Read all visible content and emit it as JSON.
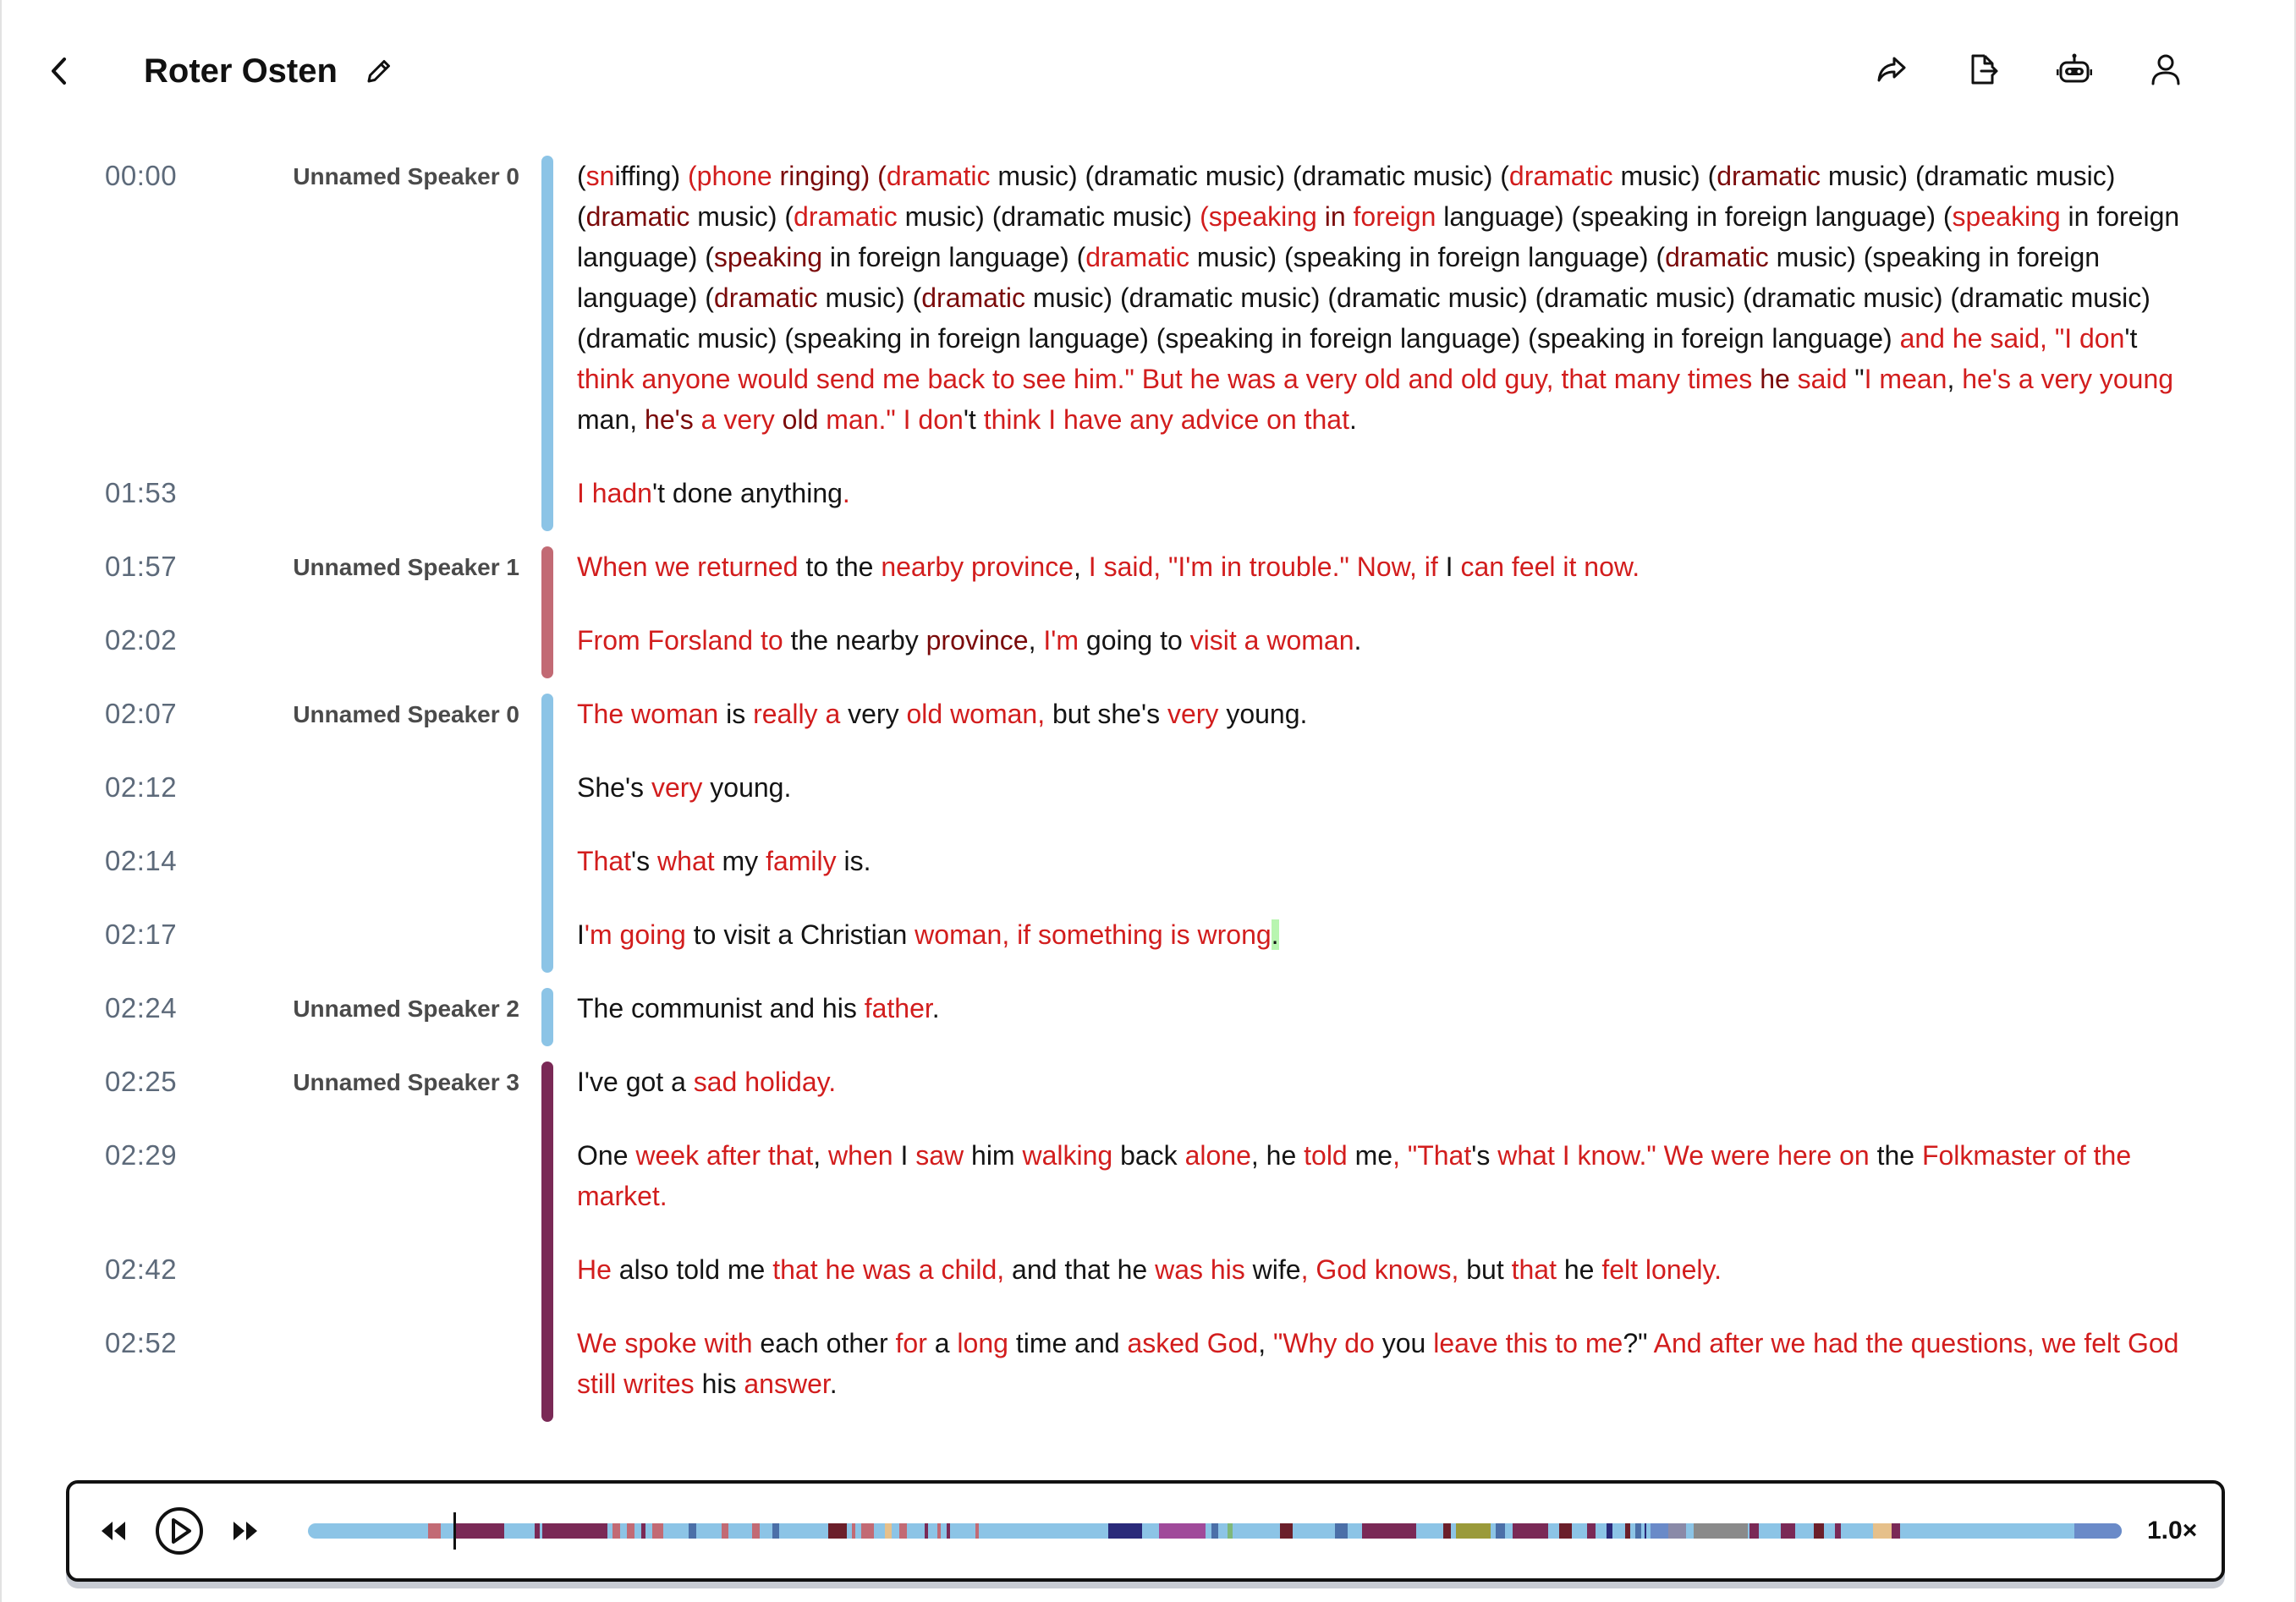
{
  "header": {
    "title": "Roter Osten",
    "icons": [
      "back-chevron-icon",
      "pencil-icon",
      "share-icon",
      "export-file-icon",
      "robot-icon",
      "user-icon"
    ]
  },
  "colors": {
    "speaker_0": "#8cc4e6",
    "speaker_1": "#c26a74",
    "speaker_2": "#8cc4e6",
    "speaker_3": "#7a2956",
    "low_confidence": "#d21d1d",
    "medium_confidence": "#7a0a0a"
  },
  "transcript": {
    "groups": [
      {
        "speaker": "Unnamed Speaker 0",
        "color": "#8cc4e6",
        "segments": [
          {
            "time": "00:00",
            "spans": [
              [
                "(",
                ""
              ],
              [
                "sn",
                "r"
              ],
              [
                "iffing) ",
                ""
              ],
              [
                "(phone",
                "r"
              ],
              [
                " ringing) (",
                "d"
              ],
              [
                "dramatic",
                "r"
              ],
              [
                " music) (dramatic music) (dramatic music) (",
                ""
              ],
              [
                "dramatic",
                "r"
              ],
              [
                " music) (",
                ""
              ],
              [
                "dramatic",
                "d"
              ],
              [
                " music) (dramatic music) (",
                ""
              ],
              [
                "dramatic",
                "d"
              ],
              [
                " music) (",
                ""
              ],
              [
                "dramatic",
                "r"
              ],
              [
                " music) (dramatic music) ",
                ""
              ],
              [
                "(speaking",
                "r"
              ],
              [
                " in ",
                "d"
              ],
              [
                "foreign",
                "r"
              ],
              [
                " language) (speaking in foreign language) (",
                ""
              ],
              [
                "speaking",
                "r"
              ],
              [
                " in foreign language) (",
                ""
              ],
              [
                "speaking",
                "d"
              ],
              [
                " in foreign language) (",
                ""
              ],
              [
                "dramatic",
                "r"
              ],
              [
                " music) (speaking in foreign language) (",
                ""
              ],
              [
                "dramatic",
                "d"
              ],
              [
                " music) (speaking in foreign language) (",
                ""
              ],
              [
                "dramatic",
                "d"
              ],
              [
                " music) (",
                ""
              ],
              [
                "dramatic",
                "d"
              ],
              [
                " music) (dramatic music) (dramatic music) (dramatic music) (dramatic music) (dramatic music) (dramatic music) (speaking in foreign language) (speaking in foreign language) (speaking in foreign language) ",
                ""
              ],
              [
                "and he said, \"I don",
                "r"
              ],
              [
                "'t ",
                ""
              ],
              [
                "think anyone would send me back to see him.\" But he was a very old and old guy, that many times",
                "r"
              ],
              [
                " he ",
                "d"
              ],
              [
                "said",
                "r"
              ],
              [
                " \"",
                ""
              ],
              [
                "I mean",
                "r"
              ],
              [
                ", ",
                ""
              ],
              [
                "he's a very young",
                "r"
              ],
              [
                " man, ",
                ""
              ],
              [
                "he's",
                "d"
              ],
              [
                " ",
                ""
              ],
              [
                "a very",
                "r"
              ],
              [
                " old ",
                "d"
              ],
              [
                "man.\" I don",
                "r"
              ],
              [
                "'t ",
                ""
              ],
              [
                "think I have any advice on that",
                "r"
              ],
              [
                ".",
                ""
              ]
            ]
          },
          {
            "time": "01:53",
            "spans": [
              [
                "I ",
                "r"
              ],
              [
                "hadn",
                "r"
              ],
              [
                "'t done anything",
                ""
              ],
              [
                ".",
                "r"
              ]
            ]
          }
        ]
      },
      {
        "speaker": "Unnamed Speaker 1",
        "color": "#c26a74",
        "segments": [
          {
            "time": "01:57",
            "spans": [
              [
                "When we returned",
                "r"
              ],
              [
                " to the ",
                ""
              ],
              [
                "nearby province",
                "r"
              ],
              [
                ", ",
                ""
              ],
              [
                "I said, \"",
                "r"
              ],
              [
                "I'm in trouble.\" Now, if",
                "r"
              ],
              [
                " I ",
                ""
              ],
              [
                "can feel it now.",
                "r"
              ]
            ]
          },
          {
            "time": "02:02",
            "spans": [
              [
                "From Forsland to",
                "r"
              ],
              [
                " the nearby ",
                ""
              ],
              [
                "province",
                "d"
              ],
              [
                ", ",
                ""
              ],
              [
                "I'm",
                "r"
              ],
              [
                " going to ",
                ""
              ],
              [
                "visit a woman",
                "r"
              ],
              [
                ".",
                ""
              ]
            ]
          }
        ]
      },
      {
        "speaker": "Unnamed Speaker 0",
        "color": "#8cc4e6",
        "segments": [
          {
            "time": "02:07",
            "spans": [
              [
                "The woman",
                "r"
              ],
              [
                " is ",
                ""
              ],
              [
                "really a",
                "r"
              ],
              [
                " very ",
                ""
              ],
              [
                "old woman,",
                "r"
              ],
              [
                " but she's ",
                ""
              ],
              [
                "very",
                "r"
              ],
              [
                " young.",
                ""
              ]
            ]
          },
          {
            "time": "02:12",
            "spans": [
              [
                "She's ",
                ""
              ],
              [
                "very",
                "r"
              ],
              [
                " young.",
                ""
              ]
            ]
          },
          {
            "time": "02:14",
            "spans": [
              [
                "That",
                "r"
              ],
              [
                "'s ",
                ""
              ],
              [
                "what",
                "r"
              ],
              [
                " my ",
                ""
              ],
              [
                "family",
                "r"
              ],
              [
                " is.",
                ""
              ]
            ]
          },
          {
            "time": "02:17",
            "spans": [
              [
                "I",
                ""
              ],
              [
                "'m going",
                "r"
              ],
              [
                " to visit a Christian ",
                ""
              ],
              [
                "woman, if something is wrong",
                "r"
              ],
              [
                ".",
                "hl"
              ]
            ]
          }
        ]
      },
      {
        "speaker": "Unnamed Speaker 2",
        "color": "#8cc4e6",
        "segments": [
          {
            "time": "02:24",
            "spans": [
              [
                "The communist and his ",
                ""
              ],
              [
                "father",
                "r"
              ],
              [
                ".",
                ""
              ]
            ]
          }
        ]
      },
      {
        "speaker": "Unnamed Speaker 3",
        "color": "#7a2956",
        "segments": [
          {
            "time": "02:25",
            "spans": [
              [
                "I've got a ",
                ""
              ],
              [
                "sad holiday.",
                "r"
              ]
            ]
          },
          {
            "time": "02:29",
            "spans": [
              [
                "One ",
                ""
              ],
              [
                "week after that",
                "r"
              ],
              [
                ", ",
                ""
              ],
              [
                "when",
                "r"
              ],
              [
                " I ",
                ""
              ],
              [
                "saw",
                "r"
              ],
              [
                " him ",
                ""
              ],
              [
                "walking",
                "r"
              ],
              [
                " back ",
                ""
              ],
              [
                "alone",
                "r"
              ],
              [
                ", he ",
                ""
              ],
              [
                "told",
                "r"
              ],
              [
                " me",
                ""
              ],
              [
                ", \"That",
                "r"
              ],
              [
                "'s ",
                ""
              ],
              [
                "what I know.\" We were here on",
                "r"
              ],
              [
                " the ",
                ""
              ],
              [
                "Folkmaster of the market.",
                "r"
              ]
            ]
          },
          {
            "time": "02:42",
            "spans": [
              [
                "He",
                "r"
              ],
              [
                " also told me ",
                ""
              ],
              [
                "that he was a child,",
                "r"
              ],
              [
                " and that he ",
                ""
              ],
              [
                "was his",
                "r"
              ],
              [
                " wife",
                ""
              ],
              [
                ", God knows,",
                "r"
              ],
              [
                " but ",
                ""
              ],
              [
                "that",
                "r"
              ],
              [
                " he ",
                ""
              ],
              [
                "felt lonely.",
                "r"
              ]
            ]
          },
          {
            "time": "02:52",
            "spans": [
              [
                "We ",
                "r"
              ],
              [
                "spoke with",
                "r"
              ],
              [
                " each other ",
                ""
              ],
              [
                "for",
                "r"
              ],
              [
                " a ",
                ""
              ],
              [
                "long",
                "r"
              ],
              [
                " time and ",
                ""
              ],
              [
                "asked God",
                "r"
              ],
              [
                ", ",
                ""
              ],
              [
                "\"Why do",
                "r"
              ],
              [
                " you ",
                ""
              ],
              [
                "leave this to me",
                "r"
              ],
              [
                "?\" ",
                ""
              ],
              [
                "And after we had the questions, we felt God still writes",
                "r"
              ],
              [
                " his ",
                ""
              ],
              [
                "answer",
                "r"
              ],
              [
                ".",
                ""
              ]
            ]
          }
        ]
      }
    ]
  },
  "player": {
    "speed": "1.0×",
    "position": 0.08,
    "timeline_segments": [
      {
        "s": 0.066,
        "e": 0.073,
        "c": "#c26a74"
      },
      {
        "s": 0.08,
        "e": 0.108,
        "c": "#7a2956"
      },
      {
        "s": 0.125,
        "e": 0.128,
        "c": "#7a2956"
      },
      {
        "s": 0.129,
        "e": 0.165,
        "c": "#7a2956"
      },
      {
        "s": 0.168,
        "e": 0.172,
        "c": "#c26a74"
      },
      {
        "s": 0.176,
        "e": 0.18,
        "c": "#c26a74"
      },
      {
        "s": 0.184,
        "e": 0.186,
        "c": "#7a2956"
      },
      {
        "s": 0.19,
        "e": 0.196,
        "c": "#c26a74"
      },
      {
        "s": 0.21,
        "e": 0.214,
        "c": "#4b6fa8"
      },
      {
        "s": 0.228,
        "e": 0.232,
        "c": "#c26a74"
      },
      {
        "s": 0.245,
        "e": 0.249,
        "c": "#c26a74"
      },
      {
        "s": 0.256,
        "e": 0.26,
        "c": "#4b6fa8"
      },
      {
        "s": 0.287,
        "e": 0.297,
        "c": "#6b1f2a"
      },
      {
        "s": 0.3,
        "e": 0.302,
        "c": "#c26a74"
      },
      {
        "s": 0.305,
        "e": 0.312,
        "c": "#c26a74"
      },
      {
        "s": 0.318,
        "e": 0.322,
        "c": "#e6c08a"
      },
      {
        "s": 0.326,
        "e": 0.33,
        "c": "#c26a74"
      },
      {
        "s": 0.34,
        "e": 0.342,
        "c": "#7a2956"
      },
      {
        "s": 0.347,
        "e": 0.349,
        "c": "#c26a74"
      },
      {
        "s": 0.352,
        "e": 0.354,
        "c": "#7a2956"
      },
      {
        "s": 0.368,
        "e": 0.37,
        "c": "#c26a74"
      },
      {
        "s": 0.441,
        "e": 0.46,
        "c": "#2a2a7a"
      },
      {
        "s": 0.469,
        "e": 0.495,
        "c": "#a04a9a"
      },
      {
        "s": 0.498,
        "e": 0.502,
        "c": "#4b6fa8"
      },
      {
        "s": 0.507,
        "e": 0.51,
        "c": "#7fb87a"
      },
      {
        "s": 0.536,
        "e": 0.543,
        "c": "#6b1f2a"
      },
      {
        "s": 0.566,
        "e": 0.573,
        "c": "#4b6fa8"
      },
      {
        "s": 0.581,
        "e": 0.611,
        "c": "#7a2956"
      },
      {
        "s": 0.626,
        "e": 0.63,
        "c": "#6b1f2a"
      },
      {
        "s": 0.633,
        "e": 0.652,
        "c": "#9a9a3a"
      },
      {
        "s": 0.655,
        "e": 0.66,
        "c": "#4b6fa8"
      },
      {
        "s": 0.664,
        "e": 0.684,
        "c": "#7a2956"
      },
      {
        "s": 0.69,
        "e": 0.697,
        "c": "#6b1f2a"
      },
      {
        "s": 0.705,
        "e": 0.71,
        "c": "#7a2956"
      },
      {
        "s": 0.716,
        "e": 0.719,
        "c": "#2a2a7a"
      },
      {
        "s": 0.726,
        "e": 0.729,
        "c": "#6b1f2a"
      },
      {
        "s": 0.732,
        "e": 0.735,
        "c": "#4b6fa8"
      },
      {
        "s": 0.737,
        "e": 0.738,
        "c": "#2a2a7a"
      },
      {
        "s": 0.74,
        "e": 0.75,
        "c": "#6a8ac8"
      },
      {
        "s": 0.795,
        "e": 0.8,
        "c": "#7a2956"
      },
      {
        "s": 0.812,
        "e": 0.82,
        "c": "#7a2956"
      },
      {
        "s": 0.83,
        "e": 0.836,
        "c": "#6b1f2a"
      },
      {
        "s": 0.842,
        "e": 0.845,
        "c": "#7a2956"
      },
      {
        "s": 0.863,
        "e": 0.873,
        "c": "#e6c08a"
      },
      {
        "s": 0.873,
        "e": 0.878,
        "c": "#7a2956"
      },
      {
        "s": 0.974,
        "e": 1.0,
        "c": "#6a8ac8"
      }
    ],
    "gray_segments": [
      {
        "s": 0.764,
        "e": 0.794,
        "c": "#8a8a8a"
      },
      {
        "s": 0.75,
        "e": 0.76,
        "c": "#8a8aa8"
      }
    ]
  }
}
